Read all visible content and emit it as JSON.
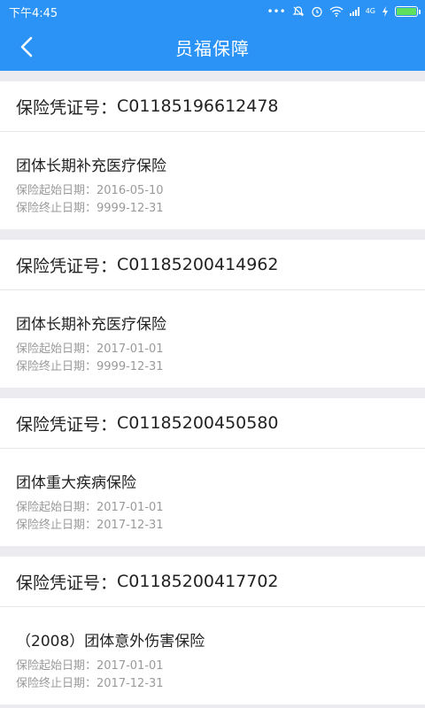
{
  "status": {
    "time": "下午4:45",
    "network": "4G",
    "colors": {
      "bar": "#2a93f5",
      "battery": "#5ee05e"
    },
    "icons": [
      "more-dots-icon",
      "mute-bell-icon",
      "alarm-icon",
      "wifi-icon",
      "signal-icon",
      "charging-icon",
      "battery-icon"
    ]
  },
  "header": {
    "title": "员福保障",
    "back_icon": "back-arrow-icon"
  },
  "policies": [
    {
      "cert_label": "保险凭证号：",
      "cert_no": "C01185196612478",
      "product": "团体长期补充医疗保险",
      "start_label": "保险起始日期：",
      "start": "2016-05-10",
      "end_label": "保险终止日期：",
      "end": "9999-12-31"
    },
    {
      "cert_label": "保险凭证号：",
      "cert_no": "C01185200414962",
      "product": "团体长期补充医疗保险",
      "start_label": "保险起始日期：",
      "start": "2017-01-01",
      "end_label": "保险终止日期：",
      "end": "9999-12-31"
    },
    {
      "cert_label": "保险凭证号：",
      "cert_no": "C01185200450580",
      "product": "团体重大疾病保险",
      "start_label": "保险起始日期：",
      "start": "2017-01-01",
      "end_label": "保险终止日期：",
      "end": "2017-12-31"
    },
    {
      "cert_label": "保险凭证号：",
      "cert_no": "C01185200417702",
      "product": "（2008）团体意外伤害保险",
      "start_label": "保险起始日期：",
      "start": "2017-01-01",
      "end_label": "保险终止日期：",
      "end": "2017-12-31"
    }
  ]
}
